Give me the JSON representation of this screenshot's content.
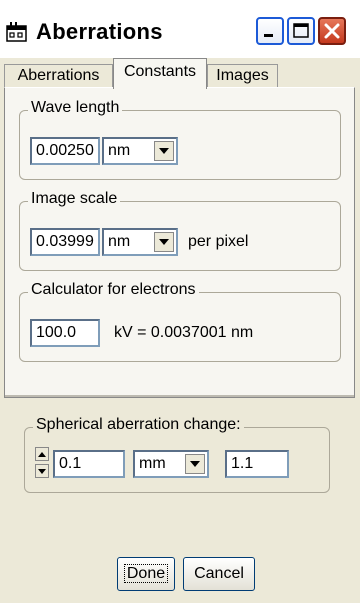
{
  "window": {
    "title": "Aberrations"
  },
  "tabs": [
    {
      "label": "Aberrations"
    },
    {
      "label": "Constants"
    },
    {
      "label": "Images"
    }
  ],
  "wavelength": {
    "legend": "Wave length",
    "value": "0.00250",
    "unit": "nm"
  },
  "image_scale": {
    "legend": "Image scale",
    "value": "0.03999",
    "unit": "nm",
    "suffix": "per pixel"
  },
  "calculator": {
    "legend": "Calculator for electrons",
    "value": "100.0",
    "result": "kV  =  0.0037001 nm"
  },
  "spherical": {
    "legend": "Spherical aberration change:",
    "value": "0.1",
    "unit": "mm",
    "factor": "1.1"
  },
  "buttons": {
    "done": "Done",
    "cancel": "Cancel"
  },
  "icons": {
    "app": "app-window-icon",
    "minimize": "minimize-icon",
    "maximize": "maximize-icon",
    "close": "close-icon"
  },
  "colors": {
    "titlebar_border": "#1c5ad7",
    "close": "#c4391e",
    "background": "#ece9d8"
  }
}
